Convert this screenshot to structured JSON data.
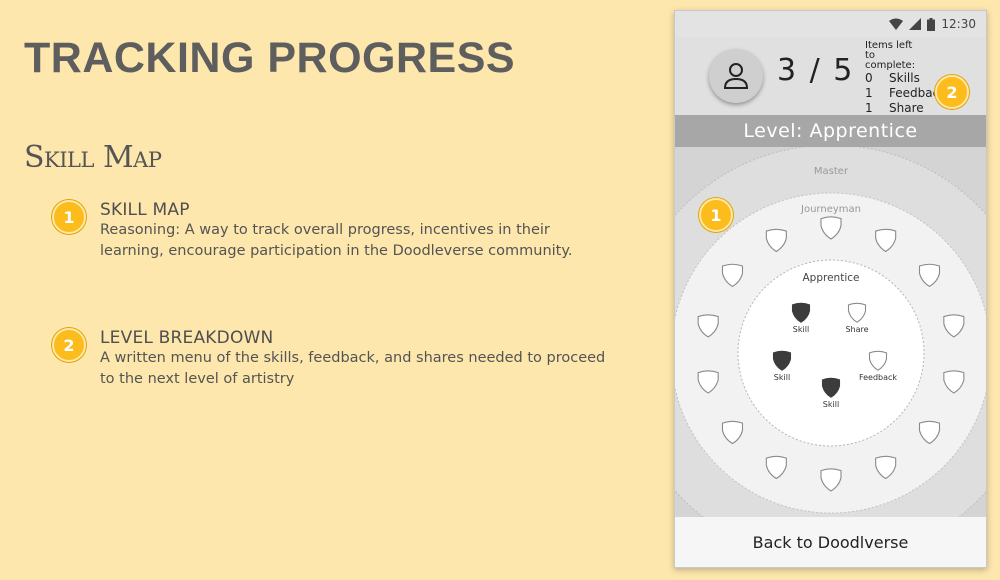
{
  "slide": {
    "title": "TRACKING PROGRESS",
    "subtitle": "Skill Map"
  },
  "notes": [
    {
      "badge": "1",
      "heading": "SKILL MAP",
      "text": "Reasoning: A way to track overall progress, incentives in their learning, encourage participation in the Doodleverse community."
    },
    {
      "badge": "2",
      "heading": "LEVEL BREAKDOWN",
      "text": "A written menu of the skills, feedback, and shares needed to proceed to the next level of artistry"
    }
  ],
  "phone": {
    "status_time": "12:30",
    "progress": "3 / 5",
    "items_left_caption": "Items left to complete:",
    "items_left": [
      {
        "count": "0",
        "label": "Skills"
      },
      {
        "count": "1",
        "label": "Feedback"
      },
      {
        "count": "1",
        "label": "Share"
      }
    ],
    "badge_1": "1",
    "badge_2": "2",
    "level_label": "Level: Apprentice",
    "rings": {
      "outer": "Master",
      "middle": "Journeyman",
      "inner": "Apprentice"
    },
    "apprentice_items": [
      {
        "label": "Skill",
        "filled": true
      },
      {
        "label": "Share",
        "filled": false
      },
      {
        "label": "Skill",
        "filled": true
      },
      {
        "label": "Feedback",
        "filled": false
      },
      {
        "label": "Skill",
        "filled": true
      }
    ],
    "back_label": "Back to Doodlverse"
  },
  "colors": {
    "background": "#fde7ad",
    "badge": "#fbbc1c",
    "level_bar": "#a7a7a7",
    "filled_shield": "#3c3c3c"
  }
}
